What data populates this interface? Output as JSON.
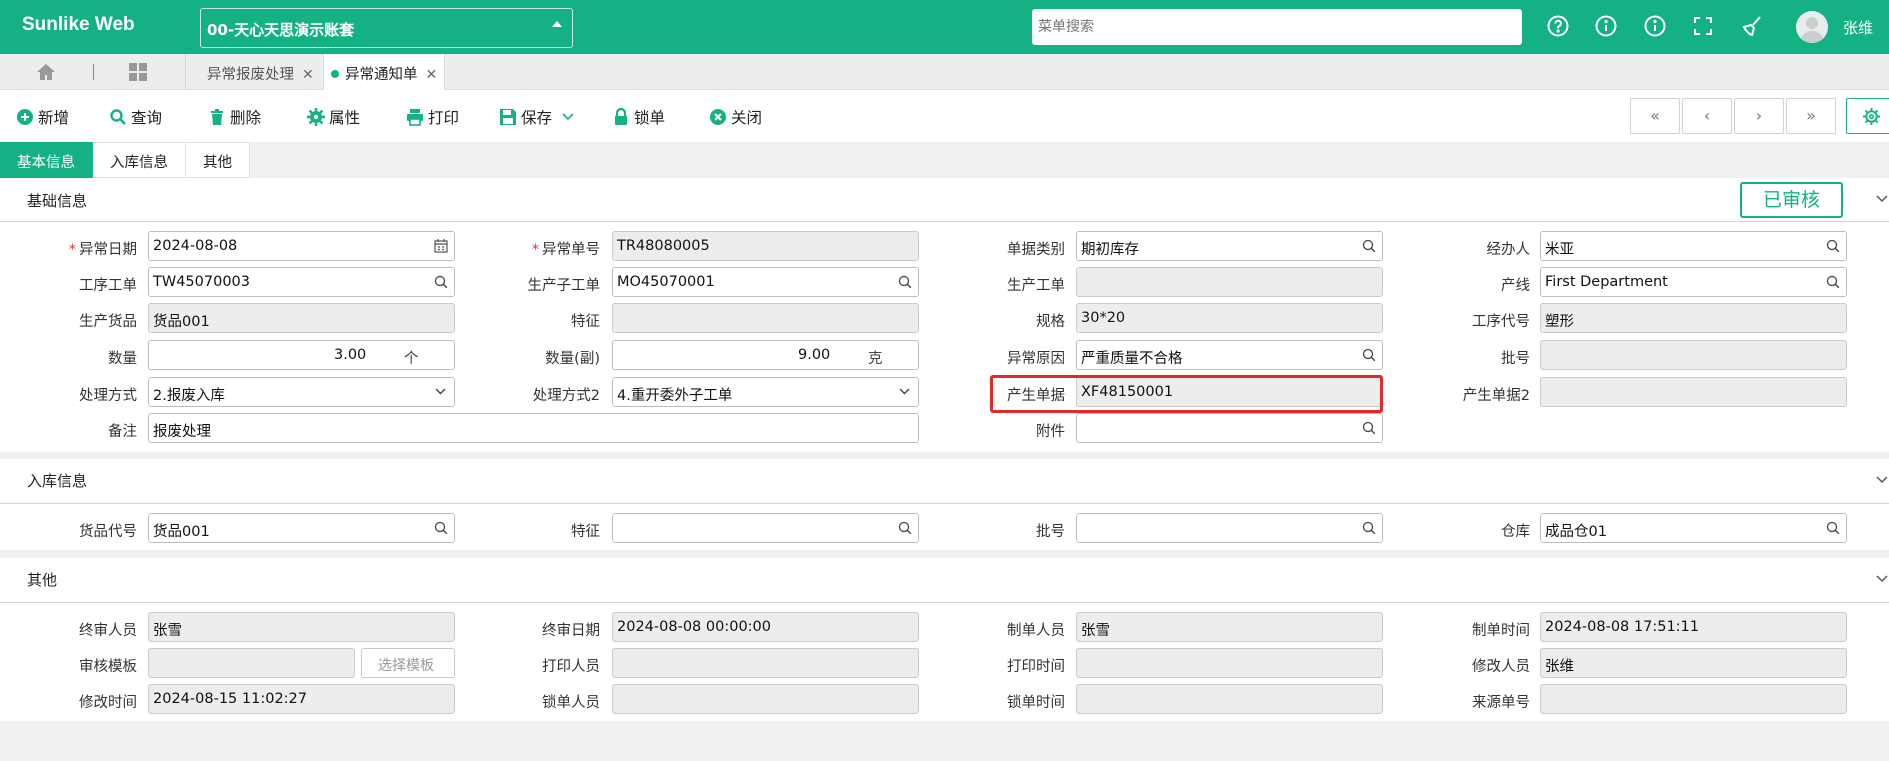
{
  "app": {
    "logo": "Sunlike Web",
    "account": "00-天心天思演示账套",
    "search_placeholder": "菜单搜索",
    "username": "张维"
  },
  "topbar_icons": [
    "help-icon",
    "info-icon",
    "about-icon",
    "fullscreen-icon",
    "clean-icon"
  ],
  "tabs": [
    {
      "label": "异常报废处理",
      "active": false
    },
    {
      "label": "异常通知单",
      "active": true
    }
  ],
  "toolbar": {
    "add": "新增",
    "query": "查询",
    "delete": "删除",
    "properties": "属性",
    "print": "打印",
    "save": "保存",
    "lock": "锁单",
    "close": "关闭"
  },
  "nav": {
    "first": "«",
    "prev": "‹",
    "next": "›",
    "last": "»"
  },
  "form_tabs": [
    "基本信息",
    "入库信息",
    "其他"
  ],
  "sections": {
    "basic": "基础信息",
    "inbound": "入库信息",
    "other": "其他"
  },
  "status_badge": "已审核",
  "basic": {
    "abnormal_date_label": "异常日期",
    "abnormal_date": "2024-08-08",
    "abnormal_no_label": "异常单号",
    "abnormal_no": "TR48080005",
    "doc_type_label": "单据类别",
    "doc_type": "期初库存",
    "handler_label": "经办人",
    "handler": "米亚",
    "process_order_label": "工序工单",
    "process_order": "TW45070003",
    "sub_order_label": "生产子工单",
    "sub_order": "MO45070001",
    "prod_order_label": "生产工单",
    "prod_order": "",
    "line_label": "产线",
    "line": "First Department",
    "goods_label": "生产货品",
    "goods": "货品001",
    "feature_label": "特征",
    "feature": "",
    "spec_label": "规格",
    "spec": "30*20",
    "process_code_label": "工序代号",
    "process_code": "塑形",
    "qty_label": "数量",
    "qty": "3.00",
    "qty_unit": "个",
    "qty2_label": "数量(副)",
    "qty2": "9.00",
    "qty2_unit": "克",
    "reason_label": "异常原因",
    "reason": "严重质量不合格",
    "batch_label": "批号",
    "batch": "",
    "method_label": "处理方式",
    "method": "2.报废入库",
    "method2_label": "处理方式2",
    "method2": "4.重开委外子工单",
    "gen_doc_label": "产生单据",
    "gen_doc": "XF48150001",
    "gen_doc2_label": "产生单据2",
    "gen_doc2": "",
    "remark_label": "备注",
    "remark": "报废处理",
    "attach_label": "附件",
    "attach": ""
  },
  "inbound": {
    "goods_code_label": "货品代号",
    "goods_code": "货品001",
    "feature_label": "特征",
    "feature": "",
    "batch_label": "批号",
    "batch": "",
    "warehouse_label": "仓库",
    "warehouse": "成品仓01"
  },
  "other": {
    "final_reviewer_label": "终审人员",
    "final_reviewer": "张雪",
    "final_date_label": "终审日期",
    "final_date": "2024-08-08 00:00:00",
    "creator_label": "制单人员",
    "creator": "张雪",
    "create_time_label": "制单时间",
    "create_time": "2024-08-08 17:51:11",
    "review_tmpl_label": "审核模板",
    "review_tmpl": "",
    "select_tmpl": "选择模板",
    "printer_label": "打印人员",
    "printer": "",
    "print_time_label": "打印时间",
    "print_time": "",
    "modifier_label": "修改人员",
    "modifier": "张维",
    "modify_time_label": "修改时间",
    "modify_time": "2024-08-15 11:02:27",
    "locker_label": "锁单人员",
    "locker": "",
    "lock_time_label": "锁单时间",
    "lock_time": "",
    "source_no_label": "来源单号",
    "source_no": ""
  }
}
